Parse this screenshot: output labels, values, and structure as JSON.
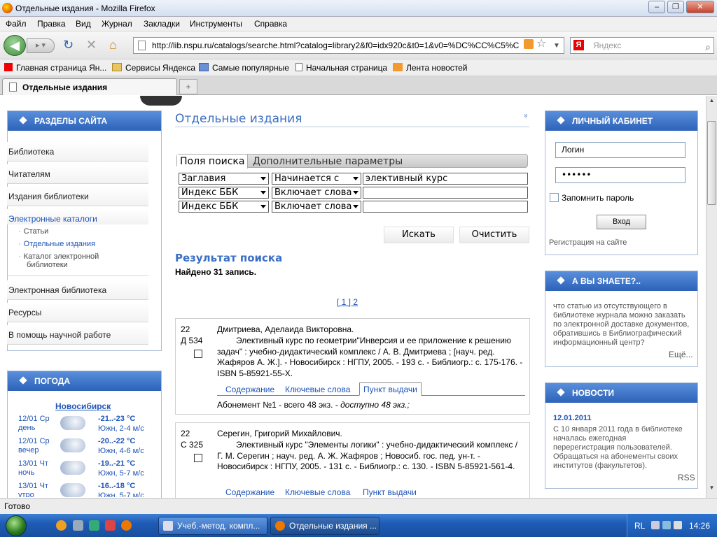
{
  "window": {
    "title": "Отдельные издания - Mozilla Firefox"
  },
  "menu": [
    "Файл",
    "Правка",
    "Вид",
    "Журнал",
    "Закладки",
    "Инструменты",
    "Справка"
  ],
  "nav": {
    "url": "http://lib.nspu.ru/catalogs/searche.html?catalog=library2&f0=idx920c&t0=1&v0=%DC%CC%C5%C",
    "search_placeholder": "Яндекс",
    "search_engine_badge": "Я"
  },
  "bookmarks": [
    "Главная страница Ян...",
    "Сервисы Яндекса",
    "Самые популярные",
    "Начальная страница",
    "Лента новостей"
  ],
  "tab": {
    "title": "Отдельные издания",
    "newtab": "+"
  },
  "left": {
    "sections_title": "РАЗДЕЛЫ САЙТА",
    "menu": [
      "Библиотека",
      "Читателям",
      "Издания библиотеки",
      "Электронные каталоги"
    ],
    "submenu": [
      "Статьи",
      "Отдельные издания",
      "Каталог электронной библиотеки"
    ],
    "menu2": [
      "Электронная библиотека",
      "Ресурсы",
      "В помощь научной работе"
    ],
    "weather_title": "ПОГОДА",
    "city": "Новосибирск",
    "weather": [
      {
        "date": "12/01 Ср",
        "part": "день",
        "temp": "-21..-23 °C",
        "wind": "Южн, 2-4 м/с"
      },
      {
        "date": "12/01 Ср",
        "part": "вечер",
        "temp": "-20..-22 °C",
        "wind": "Южн, 4-6 м/с"
      },
      {
        "date": "13/01 Чт",
        "part": "ночь",
        "temp": "-19..-21 °C",
        "wind": "Южн, 5-7 м/с"
      },
      {
        "date": "13/01 Чт",
        "part": "утро",
        "temp": "-16..-18 °C",
        "wind": "Южн, 5-7 м/с"
      }
    ]
  },
  "main": {
    "title": "Отдельные издания",
    "collapse": "»",
    "tabs": {
      "fields": "Поля поиска",
      "advanced": "Дополнительные параметры"
    },
    "rows": [
      {
        "field": "Заглавия",
        "mode": "Начинается с",
        "value": "элективный курс"
      },
      {
        "field": "Индекс ББК",
        "mode": "Включает слова",
        "value": ""
      },
      {
        "field": "Индекс ББК",
        "mode": "Включает слова",
        "value": ""
      }
    ],
    "search_btn": "Искать",
    "clear_btn": "Очистить",
    "results_title": "Результат поиска",
    "found": "Найдено 31 запись.",
    "pager": "[ 1 ]  2",
    "records": [
      {
        "code1": "22",
        "code2": "Д 534",
        "author": "Дмитриева, Аделаида Викторовна.",
        "desc": "Элективный курс по геометрии\"Инверсия и ее приложение к решению задач\" : учебно-дидактический комплекс / А. В. Дмитриева ; [науч. ред. Жафяров А. Ж.].  - Новосибирск : НГПУ, 2005. - 193 с. - Библиогр.: с. 175-176. - ISBN 5-85921-55-X.",
        "tabs": [
          "Содержание",
          "Ключевые слова",
          "Пункт выдачи"
        ],
        "holding": "Абонемент №1 - всего 48 экз. - ",
        "holding_avail": "доступно 48 экз.;"
      },
      {
        "code1": "22",
        "code2": "С 325",
        "author": "Серегин, Григорий Михайлович.",
        "desc": "Элективный курс \"Элементы логики\" : учебно-дидактический комплекс / Г. М. Серегин ; науч. ред. А. Ж. Жафяров ; Новосиб. гос. пед. ун-т.  - Новосибирск : НГПУ, 2005. - 131 с. - Библиогр.: с. 130. - ISBN 5-85921-561-4.",
        "tabs": [
          "Содержание",
          "Ключевые слова",
          "Пункт выдачи"
        ]
      }
    ]
  },
  "right": {
    "cabinet_title": "ЛИЧНЫЙ КАБИНЕТ",
    "login_value": "Логин",
    "password_value": "••••••",
    "remember": "Запомнить пароль",
    "login_btn": "Вход",
    "register": "Регистрация на сайте",
    "know_title": "А ВЫ ЗНАЕТЕ?..",
    "know_text": "что статью из отсутствующего в библиотеке журнала можно заказать по электронной доставке документов, обратившись в Библиографический информационный центр?",
    "more": "Ещё...",
    "news_title": "НОВОСТИ",
    "news_date": "12.01.2011",
    "news_text": "С 10 января 2011 года в библиотеке началась ежегодная перерегистрация пользователей. Обращаться на абонементы своих институтов (факультетов).",
    "rss": "RSS"
  },
  "status": "Готово",
  "taskbar": {
    "tasks": [
      "Учеб.-метод. компл...",
      "Отдельные издания ..."
    ],
    "lang": "RL",
    "clock": "14:26"
  }
}
